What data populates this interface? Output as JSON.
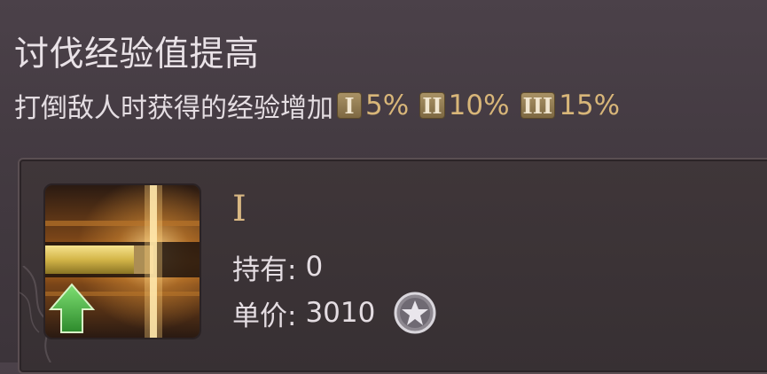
{
  "skill": {
    "title": "讨伐经验值提高",
    "description": "打倒敌人时获得的经验增加",
    "tiers": [
      {
        "badge": "I",
        "value": "5%"
      },
      {
        "badge": "II",
        "value": "10%"
      },
      {
        "badge": "III",
        "value": "15%"
      }
    ]
  },
  "item": {
    "icon": "exp-boost-icon",
    "name": "I",
    "owned_label": "持有:",
    "owned_value": "0",
    "price_label": "单价:",
    "price_value": "3010",
    "currency_icon": "star-coin-icon"
  },
  "colors": {
    "background": "#463c43",
    "panel": "#3b3336",
    "accent_gold": "#d8b679",
    "badge_gold": "#8f7a50",
    "arrow_green": "#3fb041"
  }
}
